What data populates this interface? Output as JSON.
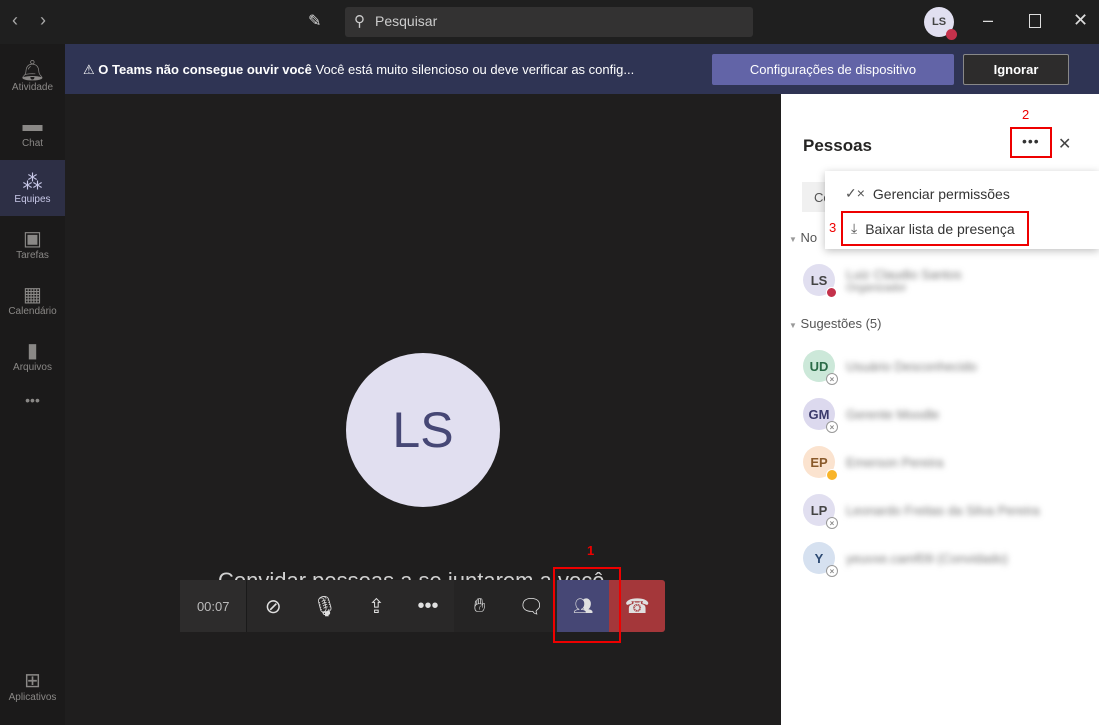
{
  "topbar": {
    "search_placeholder": "Pesquisar",
    "user_initials": "LS"
  },
  "rail": {
    "items": [
      {
        "label": "Atividade",
        "icon": "bell-icon"
      },
      {
        "label": "Chat",
        "icon": "chat-icon"
      },
      {
        "label": "Equipes",
        "icon": "teams-icon"
      },
      {
        "label": "Tarefas",
        "icon": "tasks-icon"
      },
      {
        "label": "Calendário",
        "icon": "calendar-icon"
      },
      {
        "label": "Arquivos",
        "icon": "files-icon"
      }
    ],
    "more": "•••",
    "apps": "Aplicativos"
  },
  "banner": {
    "title": "O Teams não consegue ouvir você",
    "message": "Você está muito silencioso ou deve verificar as config...",
    "primary": "Configurações de dispositivo",
    "secondary": "Ignorar"
  },
  "stage": {
    "initials": "LS",
    "invite": "Convidar pessoas a se juntarem a você"
  },
  "toolbar": {
    "timer": "00:07"
  },
  "annotations": {
    "one": "1",
    "two": "2",
    "three": "3"
  },
  "panel": {
    "title": "Pessoas",
    "search_partial": "Co",
    "section_meeting": "No",
    "section_suggestions": "Sugestões (5)",
    "organizer": {
      "initials": "LS",
      "name": "Luiz Claudio Santos",
      "role": "Organizador"
    },
    "suggestions": [
      {
        "initials": "UD",
        "name": "Usuário Desconhecido",
        "bg": "#cce8d9",
        "fg": "#2a6b47"
      },
      {
        "initials": "GM",
        "name": "Gerente Moodle",
        "bg": "#dcd9ee",
        "fg": "#3b3a6b"
      },
      {
        "initials": "EP",
        "name": "Emerson Pereira",
        "bg": "#fbe3cf",
        "fg": "#8a5a2b"
      },
      {
        "initials": "LP",
        "name": "Leonardo Freitas da Silva Pereira",
        "bg": "#e1dff0",
        "fg": "#444"
      },
      {
        "initials": "Y",
        "name": "yeuvxe.camf09 (Convidado)",
        "bg": "#d6e1f0",
        "fg": "#2d4a73"
      }
    ]
  },
  "menu": {
    "items": [
      "Gerenciar permissões",
      "Baixar lista de presença"
    ]
  }
}
